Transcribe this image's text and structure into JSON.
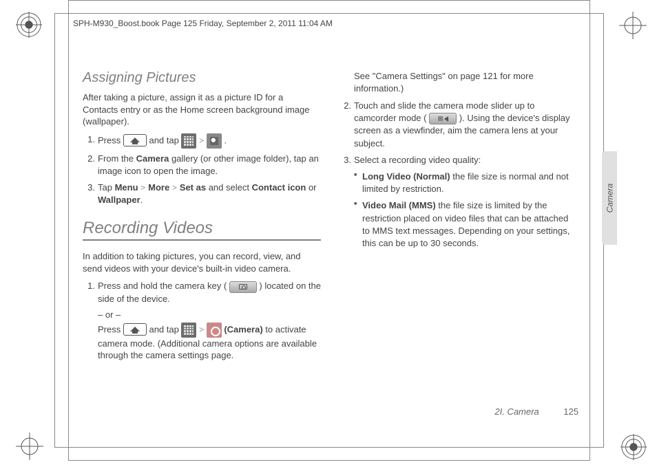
{
  "header": {
    "running": "SPH-M930_Boost.book  Page 125  Friday, September 2, 2011  11:04 AM"
  },
  "col1": {
    "assigning_title": "Assigning Pictures",
    "assigning_intro": "After taking a picture, assign it as a picture ID for a Contacts entry or as the Home screen background image (wallpaper).",
    "ap_step1_a": "Press ",
    "ap_step1_b": " and tap ",
    "ap_step1_c": " .",
    "ap_step2": "From the ",
    "ap_step2_bold": "Camera",
    "ap_step2_b": " gallery (or other image folder), tap an image icon to open the image.",
    "ap_step3_a": "Tap ",
    "ap_step3_menu": "Menu",
    "ap_step3_more": "More",
    "ap_step3_setas": "Set as",
    "ap_step3_b": " and select ",
    "ap_step3_ci": "Contact icon",
    "ap_step3_c": " or ",
    "ap_step3_wp": "Wallpaper",
    "ap_step3_d": ".",
    "recording_title": "Recording Videos",
    "recording_intro": "In addition to taking pictures, you can record, view, and send videos with your device's built-in video camera.",
    "rv_step1_a": "Press and hold the camera key ( ",
    "rv_step1_b": " ) located on the side of the device.",
    "rv_or": "– or –",
    "rv_step1c_a": "Press ",
    "rv_step1c_b": " and tap ",
    "rv_step1c_cam": "(Camera)",
    "rv_step1c_c": " to activate camera mode. (Additional camera options are available through the camera settings page."
  },
  "col2": {
    "cont": "See \"Camera Settings\" on page 121 for more information.)",
    "step2_a": "Touch and slide the camera mode slider up to camcorder mode ( ",
    "step2_b": " ). Using the device's display screen as a viewfinder, aim the camera lens at your subject.",
    "step3": "Select a recording video quality:",
    "b1_bold": "Long Video (Normal)",
    "b1_text": " the file size is normal and not limited by restriction.",
    "b2_bold": "Video Mail (MMS)",
    "b2_text": " the file size is limited by the restriction placed on video files that can be attached to MMS text messages. Depending on your settings, this can be up to 30 seconds."
  },
  "sidetab": "Camera",
  "footer": {
    "section": "2I. Camera",
    "page": "125"
  }
}
